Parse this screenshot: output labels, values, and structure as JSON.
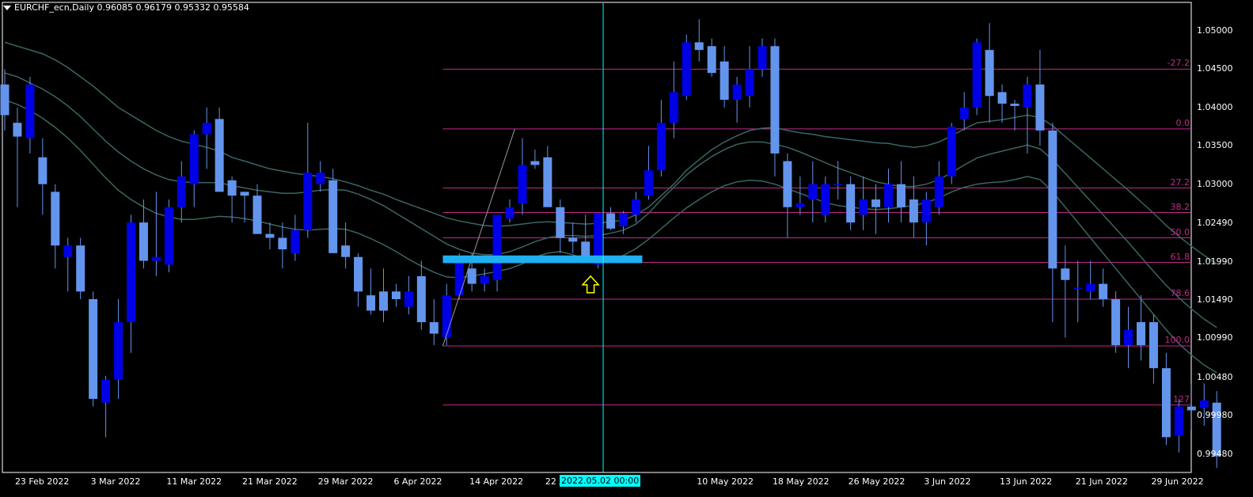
{
  "window": {
    "symbol_line": "EURCHF_ecn,Daily  0.96085 0.96179 0.95332 0.95584"
  },
  "colors": {
    "background": "#000000",
    "bull": "#0000e6",
    "bear": "#6495ed",
    "fib": "#c02a8a",
    "ma": "#3c6464",
    "cursor": "#00ffff",
    "support_zone": "#1fb0f0",
    "arrow": "#ffff00"
  },
  "cursor_label": "2022.05.02 00:00",
  "chart_data": {
    "type": "candlestick",
    "title": "EURCHF_ecn,Daily",
    "ohlc_header": [
      0.96085,
      0.96179,
      0.95332,
      0.95584
    ],
    "ylim": [
      0.9925,
      1.0535
    ],
    "yticks": [
      "1.05000",
      "1.04500",
      "1.04000",
      "1.03500",
      "1.03000",
      "1.02490",
      "1.01990",
      "1.01490",
      "1.00990",
      "1.00480",
      "0.99980",
      "0.99480"
    ],
    "x_ticks": [
      {
        "label": "23 Feb 2022",
        "index": 1
      },
      {
        "label": "3 Mar 2022",
        "index": 7
      },
      {
        "label": "11 Mar 2022",
        "index": 13
      },
      {
        "label": "21 Mar 2022",
        "index": 19
      },
      {
        "label": "29 Mar 2022",
        "index": 25
      },
      {
        "label": "6 Apr 2022",
        "index": 31
      },
      {
        "label": "14 Apr 2022",
        "index": 37
      },
      {
        "label": "22 Apr",
        "index": 43
      },
      {
        "label": "2",
        "index": 49
      },
      {
        "label": "10 May 2022",
        "index": 55
      },
      {
        "label": "18 May 2022",
        "index": 61
      },
      {
        "label": "26 May 2022",
        "index": 67
      },
      {
        "label": "3 Jun 2022",
        "index": 73
      },
      {
        "label": "13 Jun 2022",
        "index": 79
      },
      {
        "label": "21 Jun 2022",
        "index": 85
      },
      {
        "label": "29 Jun 2022",
        "index": 91
      }
    ],
    "candles": [
      [
        1.043,
        1.045,
        1.037,
        1.039
      ],
      [
        1.038,
        1.04,
        1.027,
        1.0362
      ],
      [
        1.036,
        1.044,
        1.034,
        1.043
      ],
      [
        1.0335,
        1.036,
        1.026,
        1.03
      ],
      [
        1.029,
        1.03,
        1.019,
        1.022
      ],
      [
        1.0205,
        1.023,
        1.016,
        1.022
      ],
      [
        1.022,
        1.023,
        1.015,
        1.016
      ],
      [
        1.015,
        1.016,
        1.001,
        1.002
      ],
      [
        1.0015,
        1.005,
        0.997,
        1.0045
      ],
      [
        1.0045,
        1.015,
        1.002,
        1.012
      ],
      [
        1.012,
        1.026,
        1.008,
        1.025
      ],
      [
        1.025,
        1.028,
        1.019,
        1.02
      ],
      [
        1.02,
        1.029,
        1.018,
        1.0205
      ],
      [
        1.0195,
        1.028,
        1.0185,
        1.027
      ],
      [
        1.027,
        1.033,
        1.025,
        1.031
      ],
      [
        1.03,
        1.037,
        1.027,
        1.0365
      ],
      [
        1.0365,
        1.04,
        1.032,
        1.038
      ],
      [
        1.0385,
        1.04,
        1.03,
        1.029
      ],
      [
        1.0305,
        1.031,
        1.025,
        1.0285
      ],
      [
        1.029,
        1.029,
        1.025,
        1.0285
      ],
      [
        1.0285,
        1.03,
        1.024,
        1.0235
      ],
      [
        1.0235,
        1.025,
        1.0215,
        1.023
      ],
      [
        1.023,
        1.025,
        1.019,
        1.0215
      ],
      [
        1.021,
        1.026,
        1.02,
        1.024
      ],
      [
        1.024,
        1.038,
        1.023,
        1.0315
      ],
      [
        1.03,
        1.033,
        1.029,
        1.0315
      ],
      [
        1.0305,
        1.032,
        1.026,
        1.021
      ],
      [
        1.022,
        1.025,
        1.019,
        1.0205
      ],
      [
        1.0205,
        1.021,
        1.014,
        1.016
      ],
      [
        1.0155,
        1.019,
        1.013,
        1.0135
      ],
      [
        1.016,
        1.019,
        1.012,
        1.0135
      ],
      [
        1.016,
        1.017,
        1.014,
        1.015
      ],
      [
        1.014,
        1.018,
        1.013,
        1.016
      ],
      [
        1.018,
        1.02,
        1.011,
        1.012
      ],
      [
        1.012,
        1.015,
        1.009,
        1.0105
      ],
      [
        1.01,
        1.017,
        1.009,
        1.0155
      ],
      [
        1.0155,
        1.021,
        1.015,
        1.02
      ],
      [
        1.019,
        1.021,
        1.016,
        1.017
      ],
      [
        1.017,
        1.019,
        1.016,
        1.018
      ],
      [
        1.0175,
        1.025,
        1.016,
        1.026
      ],
      [
        1.0255,
        1.028,
        1.025,
        1.027
      ],
      [
        1.0275,
        1.036,
        1.026,
        1.0325
      ],
      [
        1.033,
        1.0345,
        1.032,
        1.0325
      ],
      [
        1.0335,
        1.035,
        1.03,
        1.027
      ],
      [
        1.027,
        1.028,
        1.021,
        1.023
      ],
      [
        1.023,
        1.025,
        1.021,
        1.0225
      ],
      [
        1.0225,
        1.026,
        1.021,
        1.02
      ],
      [
        1.0195,
        1.0255,
        1.019,
        1.0262
      ],
      [
        1.0262,
        1.027,
        1.024,
        1.0242
      ],
      [
        1.0245,
        1.0265,
        1.0235,
        1.0262
      ],
      [
        1.026,
        1.029,
        1.025,
        1.028
      ],
      [
        1.0285,
        1.035,
        1.028,
        1.0318
      ],
      [
        1.0318,
        1.041,
        1.031,
        1.038
      ],
      [
        1.038,
        1.046,
        1.036,
        1.042
      ],
      [
        1.0415,
        1.0495,
        1.041,
        1.0485
      ],
      [
        1.0485,
        1.0515,
        1.046,
        1.0475
      ],
      [
        1.048,
        1.049,
        1.044,
        1.0445
      ],
      [
        1.046,
        1.048,
        1.04,
        1.041
      ],
      [
        1.041,
        1.044,
        1.038,
        1.043
      ],
      [
        1.0415,
        1.048,
        1.04,
        1.045
      ],
      [
        1.045,
        1.049,
        1.044,
        1.048
      ],
      [
        1.048,
        1.049,
        1.031,
        1.034
      ],
      [
        1.033,
        1.034,
        1.023,
        1.027
      ],
      [
        1.027,
        1.031,
        1.026,
        1.0275
      ],
      [
        1.028,
        1.033,
        1.025,
        1.03
      ],
      [
        1.026,
        1.031,
        1.025,
        1.03
      ],
      [
        1.03,
        1.033,
        1.028,
        1.03
      ],
      [
        1.03,
        1.031,
        1.024,
        1.025
      ],
      [
        1.026,
        1.031,
        1.024,
        1.028
      ],
      [
        1.028,
        1.03,
        1.0235,
        1.027
      ],
      [
        1.027,
        1.032,
        1.025,
        1.03
      ],
      [
        1.03,
        1.033,
        1.025,
        1.027
      ],
      [
        1.028,
        1.031,
        1.023,
        1.025
      ],
      [
        1.025,
        1.029,
        1.022,
        1.028
      ],
      [
        1.027,
        1.033,
        1.026,
        1.031
      ],
      [
        1.031,
        1.038,
        1.03,
        1.0375
      ],
      [
        1.0385,
        1.042,
        1.037,
        1.04
      ],
      [
        1.04,
        1.049,
        1.039,
        1.0485
      ],
      [
        1.0475,
        1.051,
        1.038,
        1.0415
      ],
      [
        1.042,
        1.043,
        1.038,
        1.0405
      ],
      [
        1.0405,
        1.041,
        1.037,
        1.0402
      ],
      [
        1.04,
        1.044,
        1.034,
        1.043
      ],
      [
        1.043,
        1.0475,
        1.035,
        1.037
      ],
      [
        1.037,
        1.038,
        1.012,
        1.019
      ],
      [
        1.019,
        1.022,
        1.01,
        1.0175
      ],
      [
        1.0165,
        1.02,
        1.012,
        1.0165
      ],
      [
        1.016,
        1.02,
        1.015,
        1.017
      ],
      [
        1.017,
        1.019,
        1.014,
        1.015
      ],
      [
        1.015,
        1.016,
        1.008,
        1.009
      ],
      [
        1.009,
        1.014,
        1.006,
        1.011
      ],
      [
        1.012,
        1.0155,
        1.007,
        1.009
      ],
      [
        1.012,
        1.013,
        1.004,
        1.006
      ],
      [
        1.006,
        1.008,
        0.996,
        0.997
      ],
      [
        0.9972,
        1.002,
        0.995,
        1.001
      ],
      [
        1.001,
        1.004,
        0.998,
        1.0005
      ],
      [
        1.0008,
        1.004,
        0.9985,
        1.0018
      ],
      [
        1.0015,
        1.003,
        0.993,
        0.9945
      ]
    ],
    "moving_averages": [
      {
        "values": [
          1.0485,
          1.048,
          1.0475,
          1.047,
          1.0462,
          1.0452,
          1.044,
          1.0428,
          1.0414,
          1.04,
          1.039,
          1.038,
          1.037,
          1.0362,
          1.0356,
          1.0352,
          1.0348,
          1.0343,
          1.0335,
          1.033,
          1.0325,
          1.032,
          1.0317,
          1.0314,
          1.0312,
          1.031,
          1.0307,
          1.0303,
          1.0298,
          1.0292,
          1.0287,
          1.028,
          1.0274,
          1.0268,
          1.0262,
          1.0256,
          1.0252,
          1.0249,
          1.0246,
          1.0245,
          1.0246,
          1.0248,
          1.025,
          1.0251,
          1.025,
          1.0249,
          1.0248,
          1.0249,
          1.0251,
          1.0253,
          1.026,
          1.027,
          1.0285,
          1.03,
          1.0318,
          1.0332,
          1.0345,
          1.0355,
          1.0363,
          1.037,
          1.0373,
          1.0374,
          1.037,
          1.0367,
          1.0365,
          1.0362,
          1.036,
          1.0358,
          1.0356,
          1.0354,
          1.0353,
          1.035,
          1.0348,
          1.035,
          1.0355,
          1.0363,
          1.0372,
          1.038,
          1.0382,
          1.0384,
          1.0387,
          1.039,
          1.0387,
          1.0376,
          1.0362,
          1.0348,
          1.0334,
          1.032,
          1.0306,
          1.0292,
          1.0277,
          1.0262,
          1.0246,
          1.0232,
          1.0219,
          1.0207,
          1.0196
        ]
      },
      {
        "values": [
          1.0445,
          1.044,
          1.0432,
          1.0424,
          1.0414,
          1.0402,
          1.0388,
          1.0372,
          1.0356,
          1.0342,
          1.033,
          1.032,
          1.0312,
          1.0306,
          1.0303,
          1.0302,
          1.0302,
          1.0302,
          1.0298,
          1.0295,
          1.0292,
          1.029,
          1.0288,
          1.0288,
          1.029,
          1.0292,
          1.0293,
          1.0292,
          1.0287,
          1.028,
          1.0272,
          1.0262,
          1.0252,
          1.0242,
          1.0232,
          1.0222,
          1.0215,
          1.021,
          1.0208,
          1.0208,
          1.0212,
          1.0218,
          1.0225,
          1.023,
          1.0233,
          1.0233,
          1.0232,
          1.0233,
          1.0236,
          1.024,
          1.0248,
          1.0262,
          1.028,
          1.0296,
          1.0312,
          1.0325,
          1.0336,
          1.0345,
          1.0352,
          1.0355,
          1.0355,
          1.0352,
          1.0348,
          1.0342,
          1.0335,
          1.0328,
          1.0321,
          1.0315,
          1.0309,
          1.0303,
          1.03,
          1.0297,
          1.0297,
          1.03,
          1.0306,
          1.0315,
          1.0325,
          1.0334,
          1.0339,
          1.0343,
          1.0347,
          1.0351,
          1.0346,
          1.0332,
          1.0314,
          1.0296,
          1.0278,
          1.026,
          1.0242,
          1.0224,
          1.0205,
          1.0186,
          1.0168,
          1.0152,
          1.0137,
          1.0124,
          1.0113
        ]
      },
      {
        "values": [
          1.041,
          1.0404,
          1.0396,
          1.0386,
          1.0374,
          1.036,
          1.0344,
          1.0326,
          1.0308,
          1.0292,
          1.028,
          1.027,
          1.0262,
          1.0257,
          1.0254,
          1.0254,
          1.0256,
          1.0258,
          1.0257,
          1.0255,
          1.0252,
          1.0248,
          1.0244,
          1.0241,
          1.024,
          1.0241,
          1.0242,
          1.0241,
          1.0236,
          1.0229,
          1.0221,
          1.0212,
          1.0202,
          1.0193,
          1.0185,
          1.0179,
          1.0178,
          1.018,
          1.0183,
          1.0186,
          1.019,
          1.0196,
          1.0205,
          1.021,
          1.0212,
          1.0208,
          1.0202,
          1.02,
          1.0202,
          1.0207,
          1.0216,
          1.0228,
          1.0242,
          1.0256,
          1.0269,
          1.028,
          1.029,
          1.0298,
          1.0303,
          1.0305,
          1.0304,
          1.03,
          1.0294,
          1.0288,
          1.0282,
          1.0276,
          1.0272,
          1.027,
          1.0268,
          1.0267,
          1.0268,
          1.027,
          1.0272,
          1.0276,
          1.0282,
          1.029,
          1.0296,
          1.03,
          1.0302,
          1.0303,
          1.0306,
          1.031,
          1.0306,
          1.029,
          1.027,
          1.025,
          1.023,
          1.021,
          1.019,
          1.017,
          1.015,
          1.013,
          1.011,
          1.0092,
          1.0077,
          1.0064,
          1.0054
        ]
      }
    ],
    "fibonacci": {
      "start_index": 34.7,
      "levels": [
        {
          "label": "-27.2",
          "price": 1.045
        },
        {
          "label": "0.0",
          "price": 1.0372
        },
        {
          "label": "27.2",
          "price": 1.0295
        },
        {
          "label": "38.2",
          "price": 1.0263
        },
        {
          "label": "50.0",
          "price": 1.023
        },
        {
          "label": "61.8",
          "price": 1.0198
        },
        {
          "label": "78.6",
          "price": 1.015
        },
        {
          "label": "100.0",
          "price": 1.0089
        },
        {
          "label": "127",
          "price": 1.0012
        }
      ]
    },
    "trend_line": {
      "from": {
        "index": 34.7,
        "price": 1.0089
      },
      "to": {
        "index": 40.4,
        "price": 1.0372
      }
    },
    "support_zone": {
      "from_index": 34.7,
      "to_index": 50.5,
      "top": 1.0207,
      "bottom": 1.0197
    },
    "marker_arrow": {
      "index": 46.4,
      "price": 1.018,
      "direction": "up"
    },
    "cursor_index": 47.4
  }
}
